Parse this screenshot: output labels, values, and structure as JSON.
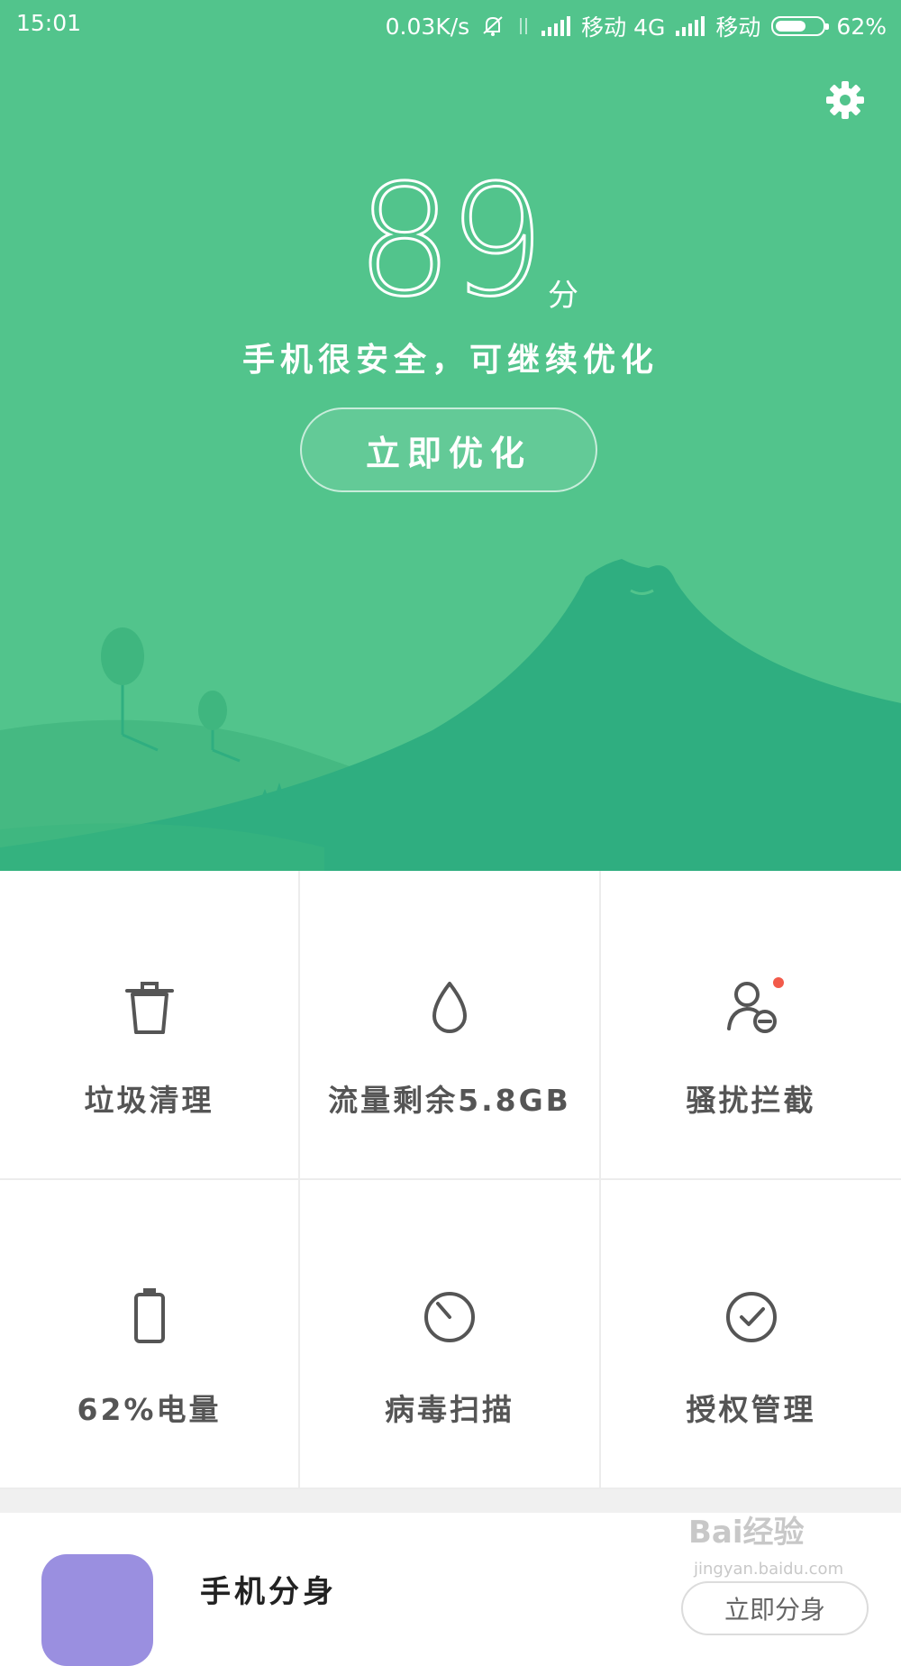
{
  "status_bar": {
    "time": "15:01",
    "net_speed": "0.03K/s",
    "carrier1": "移动 4G",
    "carrier2": "移动",
    "battery": "62%"
  },
  "hero": {
    "score": "89",
    "score_unit": "分",
    "message": "手机很安全，可继续优化",
    "optimize_label": "立即优化",
    "bg_color": "#52c48c",
    "hill_color": "#2fae80"
  },
  "grid": {
    "items": [
      {
        "label": "垃圾清理",
        "icon": "trash-icon"
      },
      {
        "label": "流量剩余5.8GB",
        "icon": "data-drop-icon",
        "badge": true
      },
      {
        "label": "骚扰拦截",
        "icon": "block-user-icon"
      },
      {
        "label": "62%电量",
        "icon": "battery-icon"
      },
      {
        "label": "病毒扫描",
        "icon": "virus-scan-icon"
      },
      {
        "label": "授权管理",
        "icon": "check-circle-icon"
      }
    ]
  },
  "feature": {
    "title": "手机分身",
    "button": "立即分身"
  },
  "watermark": {
    "text": "Bai经验",
    "sub": "jingyan.baidu.com"
  }
}
